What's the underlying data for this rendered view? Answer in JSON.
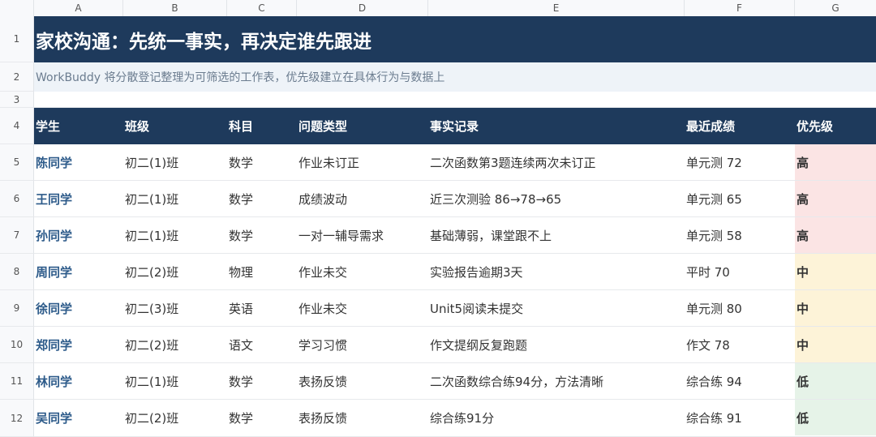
{
  "columns": [
    "A",
    "B",
    "C",
    "D",
    "E",
    "F",
    "G"
  ],
  "row_numbers": [
    "1",
    "2",
    "3",
    "4",
    "5",
    "6",
    "7",
    "8",
    "9",
    "10",
    "11",
    "12"
  ],
  "title": "家校沟通：先统一事实，再决定谁先跟进",
  "subtitle": "WorkBuddy 将分散登记整理为可筛选的工作表，优先级建立在具体行为与数据上",
  "headers": [
    "学生",
    "班级",
    "科目",
    "问题类型",
    "事实记录",
    "最近成绩",
    "优先级"
  ],
  "rows": [
    {
      "student": "陈同学",
      "class": "初二(1)班",
      "subject": "数学",
      "issue": "作业未订正",
      "fact": "二次函数第3题连续两次未订正",
      "score": "单元测 72",
      "priority": "高",
      "level": "high"
    },
    {
      "student": "王同学",
      "class": "初二(1)班",
      "subject": "数学",
      "issue": "成绩波动",
      "fact": "近三次测验 86→78→65",
      "score": "单元测 65",
      "priority": "高",
      "level": "high"
    },
    {
      "student": "孙同学",
      "class": "初二(1)班",
      "subject": "数学",
      "issue": "一对一辅导需求",
      "fact": "基础薄弱，课堂跟不上",
      "score": "单元测 58",
      "priority": "高",
      "level": "high"
    },
    {
      "student": "周同学",
      "class": "初二(2)班",
      "subject": "物理",
      "issue": "作业未交",
      "fact": "实验报告逾期3天",
      "score": "平时 70",
      "priority": "中",
      "level": "mid"
    },
    {
      "student": "徐同学",
      "class": "初二(3)班",
      "subject": "英语",
      "issue": "作业未交",
      "fact": "Unit5阅读未提交",
      "score": "单元测 80",
      "priority": "中",
      "level": "mid"
    },
    {
      "student": "郑同学",
      "class": "初二(2)班",
      "subject": "语文",
      "issue": "学习习惯",
      "fact": "作文提纲反复跑题",
      "score": "作文 78",
      "priority": "中",
      "level": "mid"
    },
    {
      "student": "林同学",
      "class": "初二(1)班",
      "subject": "数学",
      "issue": "表扬反馈",
      "fact": "二次函数综合练94分，方法清晰",
      "score": "综合练 94",
      "priority": "低",
      "level": "low"
    },
    {
      "student": "吴同学",
      "class": "初二(2)班",
      "subject": "数学",
      "issue": "表扬反馈",
      "fact": "综合练91分",
      "score": "综合练 91",
      "priority": "低",
      "level": "low"
    }
  ],
  "colors": {
    "header_bg": "#1e3a5c",
    "subtitle_bg": "#eef3f8",
    "student_text": "#2d5b8a",
    "priority_high": "#b52a2a",
    "priority_mid": "#a8740d",
    "priority_low": "#2e7d3e"
  }
}
